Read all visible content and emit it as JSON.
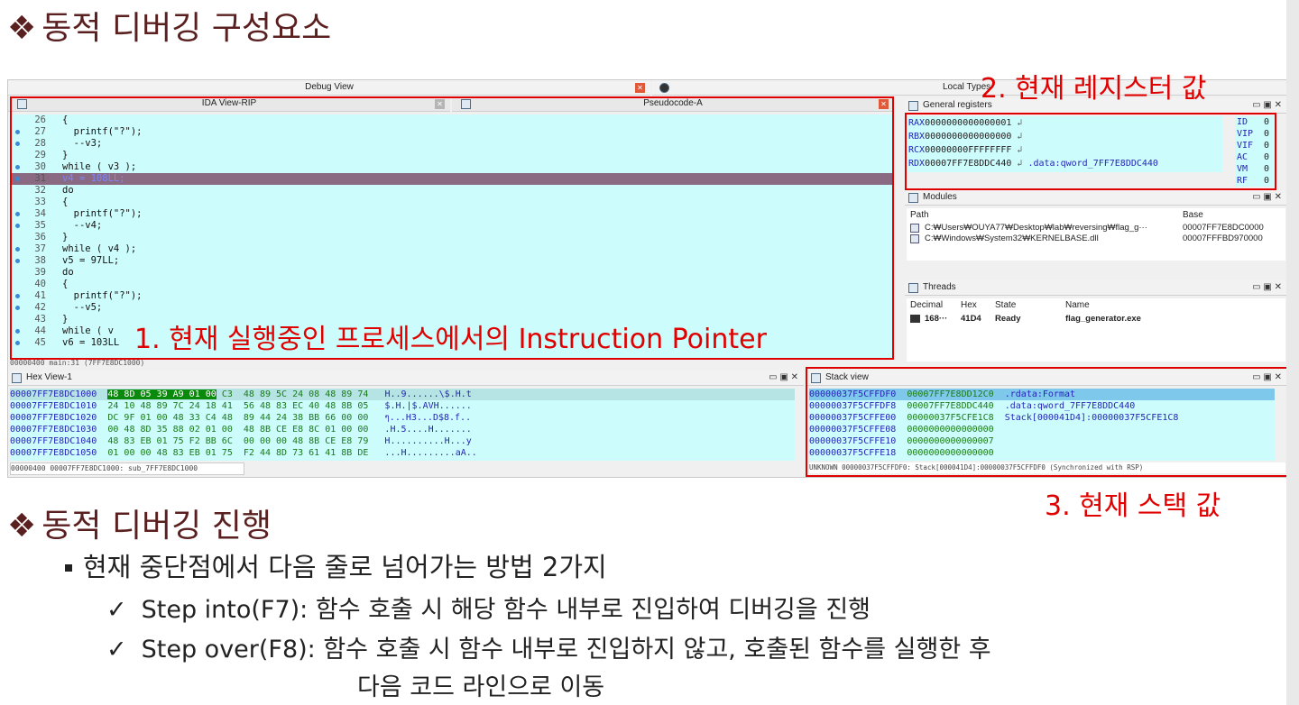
{
  "heading1": "동적 디버깅 구성요소",
  "heading2": "동적 디버깅 진행",
  "diamond": "❖",
  "debug_view_title": "Debug View",
  "local_types_title": "Local Types",
  "ida_view_title": "IDA View-RIP",
  "pseudocode_title": "Pseudocode-A",
  "code_lines": [
    {
      "ln": "26",
      "dot": false,
      "text": "{"
    },
    {
      "ln": "27",
      "dot": true,
      "text": "  printf(\"?\");"
    },
    {
      "ln": "28",
      "dot": true,
      "text": "  --v3;"
    },
    {
      "ln": "29",
      "dot": false,
      "text": "}"
    },
    {
      "ln": "30",
      "dot": true,
      "text": "while ( v3 );"
    },
    {
      "ln": "31",
      "dot": true,
      "text": "v4 = 108LL;",
      "hl": true
    },
    {
      "ln": "32",
      "dot": false,
      "text": "do"
    },
    {
      "ln": "33",
      "dot": false,
      "text": "{"
    },
    {
      "ln": "34",
      "dot": true,
      "text": "  printf(\"?\");"
    },
    {
      "ln": "35",
      "dot": true,
      "text": "  --v4;"
    },
    {
      "ln": "36",
      "dot": false,
      "text": "}"
    },
    {
      "ln": "37",
      "dot": true,
      "text": "while ( v4 );"
    },
    {
      "ln": "38",
      "dot": true,
      "text": "v5 = 97LL;"
    },
    {
      "ln": "39",
      "dot": false,
      "text": "do"
    },
    {
      "ln": "40",
      "dot": false,
      "text": "{"
    },
    {
      "ln": "41",
      "dot": true,
      "text": "  printf(\"?\");"
    },
    {
      "ln": "42",
      "dot": true,
      "text": "  --v5;"
    },
    {
      "ln": "43",
      "dot": false,
      "text": "}"
    },
    {
      "ln": "44",
      "dot": true,
      "text": "while ( v"
    },
    {
      "ln": "45",
      "dot": true,
      "text": "v6 = 103LL"
    }
  ],
  "code_status": "00000400 main:31 (7FF7E8DC1000)",
  "annotation1": "1. 현재 실행중인 프로세스에서의 Instruction Pointer",
  "annotation2": "2. 현재 레지스터 값",
  "annotation3": "3. 현재 스택 값",
  "general_registers_title": "General registers",
  "registers": [
    {
      "name": "RAX",
      "value": "0000000000000001",
      "extra": ""
    },
    {
      "name": "RBX",
      "value": "0000000000000000",
      "extra": ""
    },
    {
      "name": "RCX",
      "value": "00000000FFFFFFFF",
      "extra": ""
    },
    {
      "name": "RDX",
      "value": "00007FF7E8DDC440",
      "extra": ".data:qword_7FF7E8DDC440"
    }
  ],
  "flags": [
    {
      "name": "ID",
      "value": "0"
    },
    {
      "name": "VIP",
      "value": "0"
    },
    {
      "name": "VIF",
      "value": "0"
    },
    {
      "name": "AC",
      "value": "0"
    },
    {
      "name": "VM",
      "value": "0"
    },
    {
      "name": "RF",
      "value": "0"
    }
  ],
  "modules_title": "Modules",
  "modules_cols": {
    "path": "Path",
    "base": "Base"
  },
  "modules": [
    {
      "path": "C:₩Users₩OUYA77₩Desktop₩lab₩reversing₩flag_g···",
      "base": "00007FF7E8DC0000"
    },
    {
      "path": "C:₩Windows₩System32₩KERNELBASE.dll",
      "base": "00007FFFBD970000"
    }
  ],
  "threads_title": "Threads",
  "threads_cols": {
    "decimal": "Decimal",
    "hex": "Hex",
    "state": "State",
    "name": "Name"
  },
  "threads": [
    {
      "decimal": "168···",
      "hex": "41D4",
      "state": "Ready",
      "name": "flag_generator.exe"
    }
  ],
  "hex_view_title": "Hex View-1",
  "hex_rows": [
    {
      "addr": "00007FF7E8DC1000",
      "hex1": "48 8D 05 39 A9 01 00",
      "hex2": "C3  48 89 5C 24 08 48 89 74",
      "ascii": "H..9......\\$.H.t"
    },
    {
      "addr": "00007FF7E8DC1010",
      "hex1": "",
      "hex2": "24 10 48 89 7C 24 18 41  56 48 83 EC 40 48 8B 05",
      "ascii": "$.H.|$.AVH......"
    },
    {
      "addr": "00007FF7E8DC1020",
      "hex1": "",
      "hex2": "DC 9F 01 00 48 33 C4 48  89 44 24 38 BB 66 00 00",
      "ascii": "ๆ...H3...D$8.f.."
    },
    {
      "addr": "00007FF7E8DC1030",
      "hex1": "",
      "hex2": "00 48 8D 35 88 02 01 00  48 8B CE E8 8C 01 00 00",
      "ascii": ".H.5....H......."
    },
    {
      "addr": "00007FF7E8DC1040",
      "hex1": "",
      "hex2": "48 83 EB 01 75 F2 BB 6C  00 00 00 48 8B CE E8 79",
      "ascii": "H..........H...y"
    },
    {
      "addr": "00007FF7E8DC1050",
      "hex1": "",
      "hex2": "01 00 00 48 83 EB 01 75  F2 44 8D 73 61 41 8B DE",
      "ascii": "...H.........aA.."
    }
  ],
  "hex_status": "00000400 00007FF7E8DC1000: sub_7FF7E8DC1000",
  "stack_view_title": "Stack view",
  "stack_rows": [
    {
      "addr": "00000037F5CFFDF0",
      "value": "00007FF7E8DD12C0",
      "info": ".rdata:Format"
    },
    {
      "addr": "00000037F5CFFDF8",
      "value": "00007FF7E8DDC440",
      "info": ".data:qword_7FF7E8DDC440"
    },
    {
      "addr": "00000037F5CFFE00",
      "value": "00000037F5CFE1C8",
      "info": "Stack[000041D4]:00000037F5CFE1C8"
    },
    {
      "addr": "00000037F5CFFE08",
      "value": "0000000000000000",
      "info": ""
    },
    {
      "addr": "00000037F5CFFE10",
      "value": "0000000000000007",
      "info": ""
    },
    {
      "addr": "00000037F5CFFE18",
      "value": "0000000000000000",
      "info": ""
    }
  ],
  "stack_status": "UNKNOWN 00000037F5CFFDF0: Stack[000041D4]:00000037F5CFFDF0 (Synchronized with RSP)",
  "bullet1": "현재 중단점에서 다음 줄로 넘어가는 방법 2가지",
  "check": "✓",
  "check1": "Step into(F7): 함수 호출 시 해당 함수 내부로 진입하여 디버깅을 진행",
  "check2": "Step over(F8): 함수 호출 시 함수 내부로 진입하지 않고, 호출된 함수를 실행한 후",
  "check2_cont": "다음 코드 라인으로 이동",
  "colors": {
    "accent_red": "#e00000",
    "heading": "#5a1f1f",
    "cyan_bg": "#ccfcfc",
    "highlight_row": "#8a6a82"
  }
}
